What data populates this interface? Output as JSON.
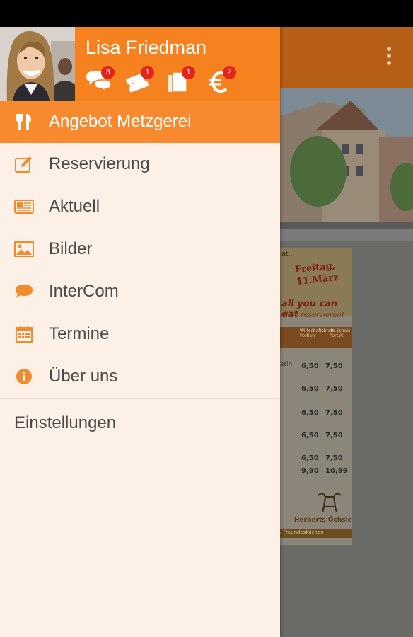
{
  "user": {
    "name": "Lisa Friedman"
  },
  "header_icons": [
    {
      "icon": "chat-icon",
      "badge": "3"
    },
    {
      "icon": "ticket-icon",
      "badge": "1"
    },
    {
      "icon": "documents-icon",
      "badge": "1"
    },
    {
      "icon": "euro-icon",
      "badge": "2"
    }
  ],
  "menu": [
    {
      "label": "Angebot Metzgerei",
      "icon": "cutlery-icon",
      "active": true
    },
    {
      "label": "Reservierung",
      "icon": "edit-icon"
    },
    {
      "label": "Aktuell",
      "icon": "newspaper-icon"
    },
    {
      "label": "Bilder",
      "icon": "image-icon"
    },
    {
      "label": "InterCom",
      "icon": "chat-bubble-icon"
    },
    {
      "label": "Termine",
      "icon": "calendar-icon"
    },
    {
      "label": "Über uns",
      "icon": "info-icon"
    }
  ],
  "settings_label": "Einstellungen",
  "background": {
    "flyer": {
      "date_line1": "Freitag,",
      "date_line2": "11.März",
      "headline": "all you can eat",
      "subline": "nline reservieren!",
      "partial_top": "iat...",
      "col_head_1": "Wirtschaftsbrett Portion",
      "col_head_2": "Im Schale Port./€",
      "rows": [
        [
          "6,50",
          "7,50"
        ],
        [
          "6,50",
          "7,50"
        ],
        [
          "6,50",
          "7,50"
        ],
        [
          "6,50",
          "7,50"
        ],
        [
          "6,50",
          "7,50"
        ],
        [
          "9,90",
          "10,99"
        ]
      ],
      "side_text_1": "atin",
      "logo_text": "Herberts Öchsle",
      "footer_text": "/ Freundesküchen"
    }
  },
  "colors": {
    "accent": "#f6821f",
    "active_row": "#f78a2f",
    "drawer_bg": "#fdf0e6",
    "icon": "#f28a2e",
    "badge": "#e5231b"
  }
}
